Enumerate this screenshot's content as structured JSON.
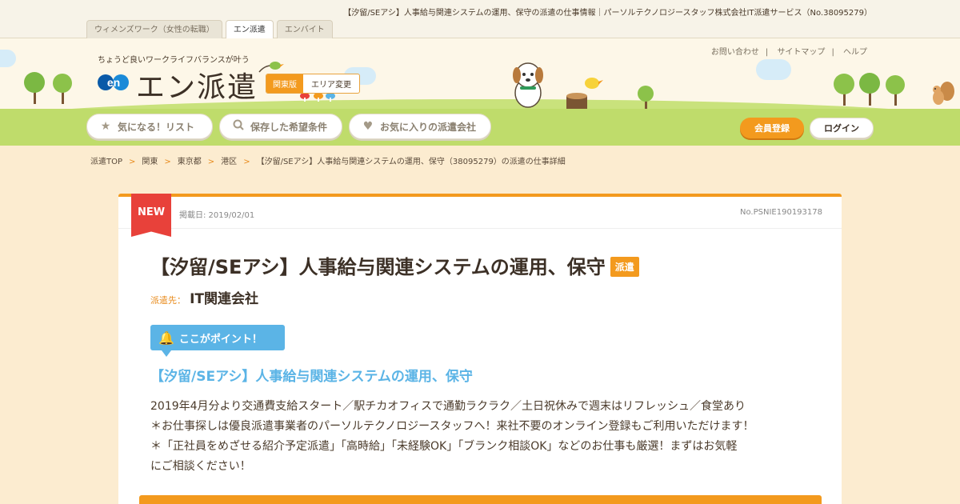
{
  "browser": {
    "page_title": "【汐留/SEアシ】人事給与関連システムの運用、保守の派遣の仕事情報｜パーソルテクノロジースタッフ株式会社IT派遣サービス（No.38095279）"
  },
  "site_tabs": [
    {
      "label": "ウィメンズワーク（女性の転職）",
      "active": false
    },
    {
      "label": "エン派遣",
      "active": true
    },
    {
      "label": "エンバイト",
      "active": false
    }
  ],
  "header": {
    "tagline": "ちょうど良いワークライフバランスが叶う",
    "logo_mark": "en",
    "logo_text": "エン派遣",
    "region_label": "関東版",
    "region_change": "エリア変更",
    "util_links": [
      "お問い合わせ",
      "サイトマップ",
      "ヘルプ"
    ],
    "nav": [
      {
        "label": "気になる！リスト",
        "icon": "star-icon"
      },
      {
        "label": "保存した希望条件",
        "icon": "search-icon"
      },
      {
        "label": "お気に入りの派遣会社",
        "icon": "heart-icon"
      }
    ],
    "register": "会員登録",
    "login": "ログイン"
  },
  "breadcrumb": {
    "items": [
      "派遣TOP",
      "関東",
      "東京都",
      "港区",
      "【汐留/SEアシ】人事給与関連システムの運用、保守（38095279）の派遣の仕事詳細"
    ],
    "separator": ">"
  },
  "job": {
    "new_badge": "NEW",
    "posted": "掲載日: 2019/02/01",
    "job_no": "No.PSNIE190193178",
    "title": "【汐留/SEアシ】人事給与関連システムの運用、保守",
    "type_badge": "派遣",
    "dest_label": "派遣先：",
    "dest_name": "IT関連会社",
    "point_label": "ここがポイント！",
    "subheading": "【汐留/SEアシ】人事給与関連システムの運用、保守",
    "description": [
      "2019年4月分より交通費支給スタート／駅チカオフィスで通勤ラクラク／土日祝休みで週末はリフレッシュ／食堂あり",
      "＊お仕事探しは優良派遣事業者のパーソルテクノロジースタッフへ！来社不要のオンライン登録もご利用いただけます！",
      "＊「正社員をめざせる紹介予定派遣」「高時給」「未経験OK」「ブランク相談OK」などのお仕事も厳選！まずはお気軽",
      "にご相談ください！"
    ]
  },
  "colors": {
    "accent": "#f39a1e",
    "new_badge": "#e8413a",
    "point_blue": "#5bb4e6",
    "page_bg": "#fcecd0"
  }
}
